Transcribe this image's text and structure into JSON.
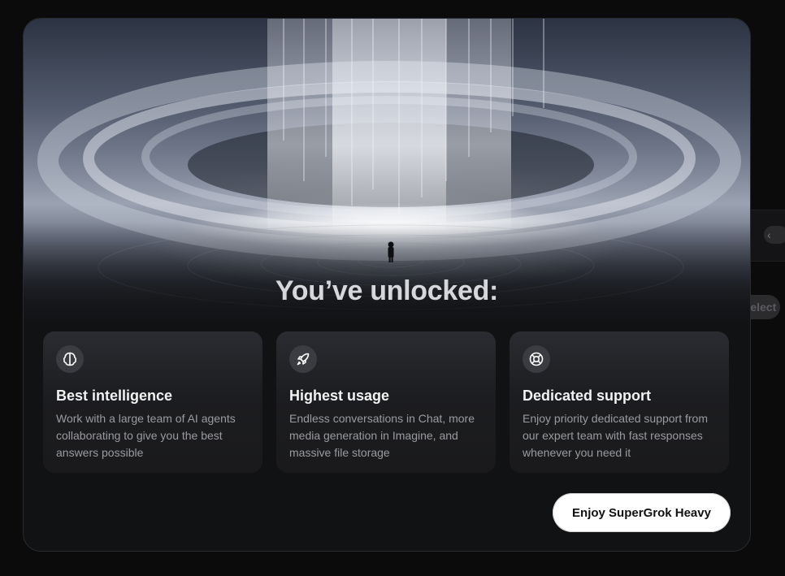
{
  "background": {
    "chevron_icon": "chevron-left-icon",
    "chevron_glyph": "‹",
    "select_label": "Select"
  },
  "modal": {
    "title": "You’ve unlocked:",
    "cards": [
      {
        "icon": "brain-icon",
        "title": "Best intelligence",
        "description": "Work with a large team of AI agents collaborating to give you the best answers possible"
      },
      {
        "icon": "rocket-icon",
        "title": "Highest usage",
        "description": "Endless conversations in Chat, more media generation in Imagine, and massive file storage"
      },
      {
        "icon": "lifebuoy-icon",
        "title": "Dedicated support",
        "description": "Enjoy priority dedicated support from our expert team with fast responses whenever you need it"
      }
    ],
    "cta_label": "Enjoy SuperGrok Heavy"
  },
  "colors": {
    "modal_bg": "#111214",
    "card_bg": "#1c1d20",
    "cta_bg": "#ffffff",
    "title_text": "#d6d7da"
  }
}
